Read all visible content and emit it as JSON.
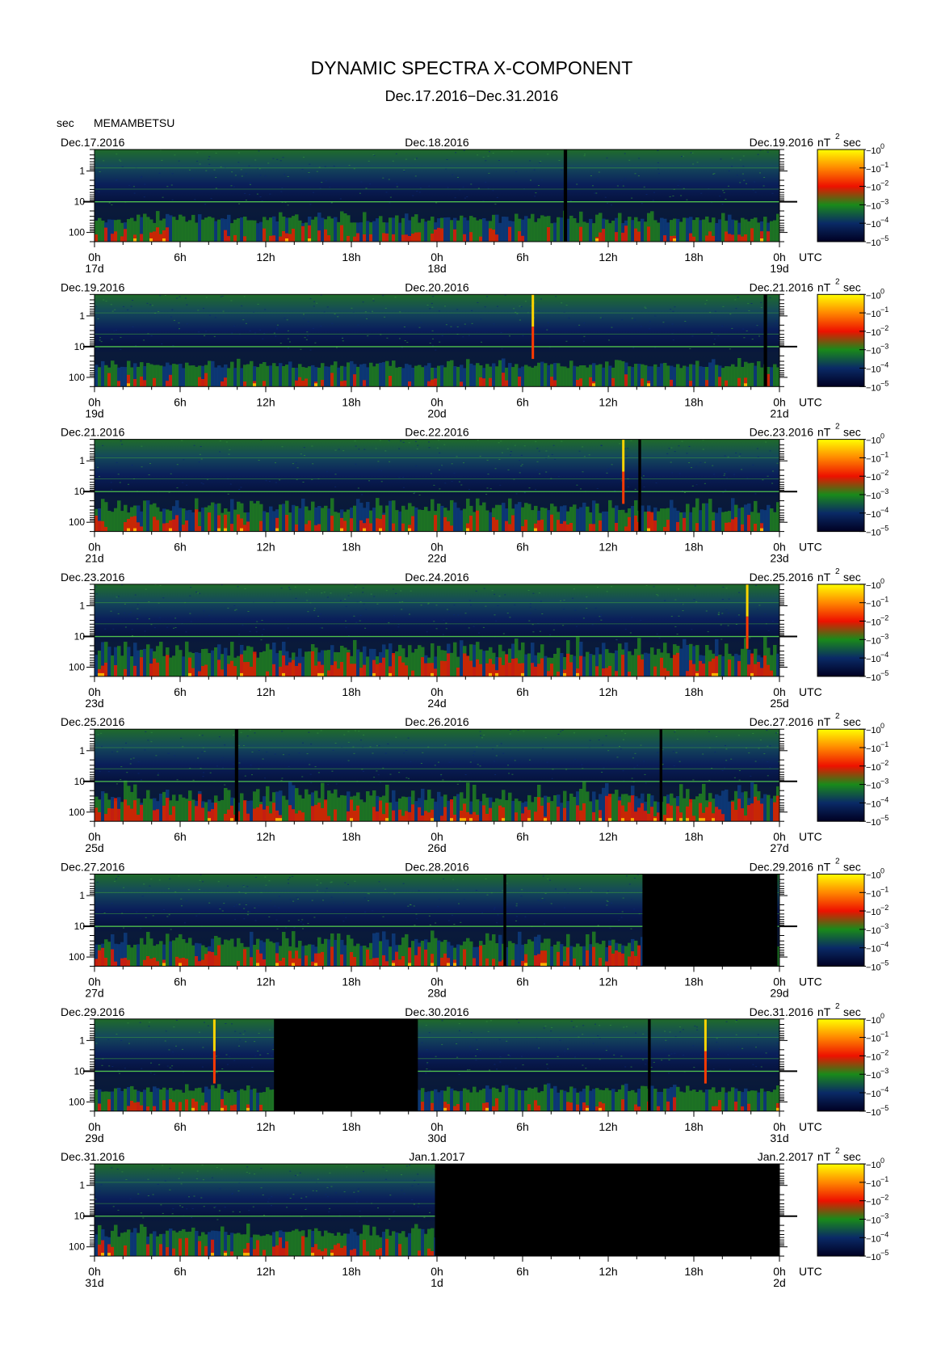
{
  "title": "DYNAMIC SPECTRA X-COMPONENT",
  "subtitle": "Dec.17.2016−Dec.31.2016",
  "yaxis_unit": "sec",
  "station": "MEMAMBETSU",
  "utc_label": "UTC",
  "colorbar_unit_base": "nT",
  "colorbar_unit_exp": "2",
  "colorbar_unit_tail": "sec",
  "chart_data": {
    "type": "heatmap",
    "y_scale": "log",
    "y_ticks": [
      "1",
      "10",
      "100"
    ],
    "x_tick_labels": [
      "0h",
      "6h",
      "12h",
      "18h",
      "0h",
      "6h",
      "12h",
      "18h",
      "0h"
    ],
    "colorbar": {
      "scale": "log",
      "ticks": [
        {
          "base": "10",
          "exp": "0"
        },
        {
          "base": "10",
          "exp": "−1"
        },
        {
          "base": "10",
          "exp": "−2"
        },
        {
          "base": "10",
          "exp": "−3"
        },
        {
          "base": "10",
          "exp": "−4"
        },
        {
          "base": "10",
          "exp": "−5"
        }
      ],
      "colors": [
        "#ffff00",
        "#ff8800",
        "#ee1100",
        "#1a8a1a",
        "#0a2a66",
        "#000022"
      ]
    },
    "panels": [
      {
        "date_left": "Dec.17.2016",
        "date_mid": "Dec.18.2016",
        "date_right": "Dec.19.2016",
        "day_left": "17d",
        "day_mid": "18d",
        "day_right": "19d",
        "activity": 0.45,
        "gaps": [
          [
            0.685,
            0.69
          ]
        ],
        "spikes": []
      },
      {
        "date_left": "Dec.19.2016",
        "date_mid": "Dec.20.2016",
        "date_right": "Dec.21.2016",
        "day_left": "19d",
        "day_mid": "20d",
        "day_right": "21d",
        "activity": 0.35,
        "gaps": [
          [
            0.977,
            0.982
          ]
        ],
        "spikes": [
          0.64
        ]
      },
      {
        "date_left": "Dec.21.2016",
        "date_mid": "Dec.22.2016",
        "date_right": "Dec.23.2016",
        "day_left": "21d",
        "day_mid": "22d",
        "day_right": "23d",
        "activity": 0.6,
        "gaps": [
          [
            0.794,
            0.798
          ]
        ],
        "spikes": [
          0.772
        ]
      },
      {
        "date_left": "Dec.23.2016",
        "date_mid": "Dec.24.2016",
        "date_right": "Dec.25.2016",
        "day_left": "23d",
        "day_mid": "24d",
        "day_right": "25d",
        "activity": 0.75,
        "gaps": [],
        "spikes": [
          0.953
        ]
      },
      {
        "date_left": "Dec.25.2016",
        "date_mid": "Dec.26.2016",
        "date_right": "Dec.27.2016",
        "day_left": "25d",
        "day_mid": "26d",
        "day_right": "27d",
        "activity": 0.8,
        "gaps": [
          [
            0.205,
            0.21
          ],
          [
            0.825,
            0.829
          ]
        ],
        "spikes": []
      },
      {
        "date_left": "Dec.27.2016",
        "date_mid": "Dec.28.2016",
        "date_right": "Dec.29.2016",
        "day_left": "27d",
        "day_mid": "28d",
        "day_right": "29d",
        "activity": 0.65,
        "gaps": [
          [
            0.597,
            0.601
          ],
          [
            0.8,
            0.997
          ]
        ],
        "spikes": []
      },
      {
        "date_left": "Dec.29.2016",
        "date_mid": "Dec.30.2016",
        "date_right": "Dec.31.2016",
        "day_left": "29d",
        "day_mid": "30d",
        "day_right": "31d",
        "activity": 0.35,
        "gaps": [
          [
            0.262,
            0.472
          ],
          [
            0.808,
            0.812
          ]
        ],
        "spikes": [
          0.175,
          0.892
        ]
      },
      {
        "date_left": "Dec.31.2016",
        "date_mid": "Jan.1.2017",
        "date_right": "Jan.2.2017",
        "day_left": "31d",
        "day_mid": "1d",
        "day_right": "2d",
        "activity": 0.55,
        "gaps": [
          [
            0.497,
            1.0
          ]
        ],
        "spikes": []
      }
    ]
  }
}
